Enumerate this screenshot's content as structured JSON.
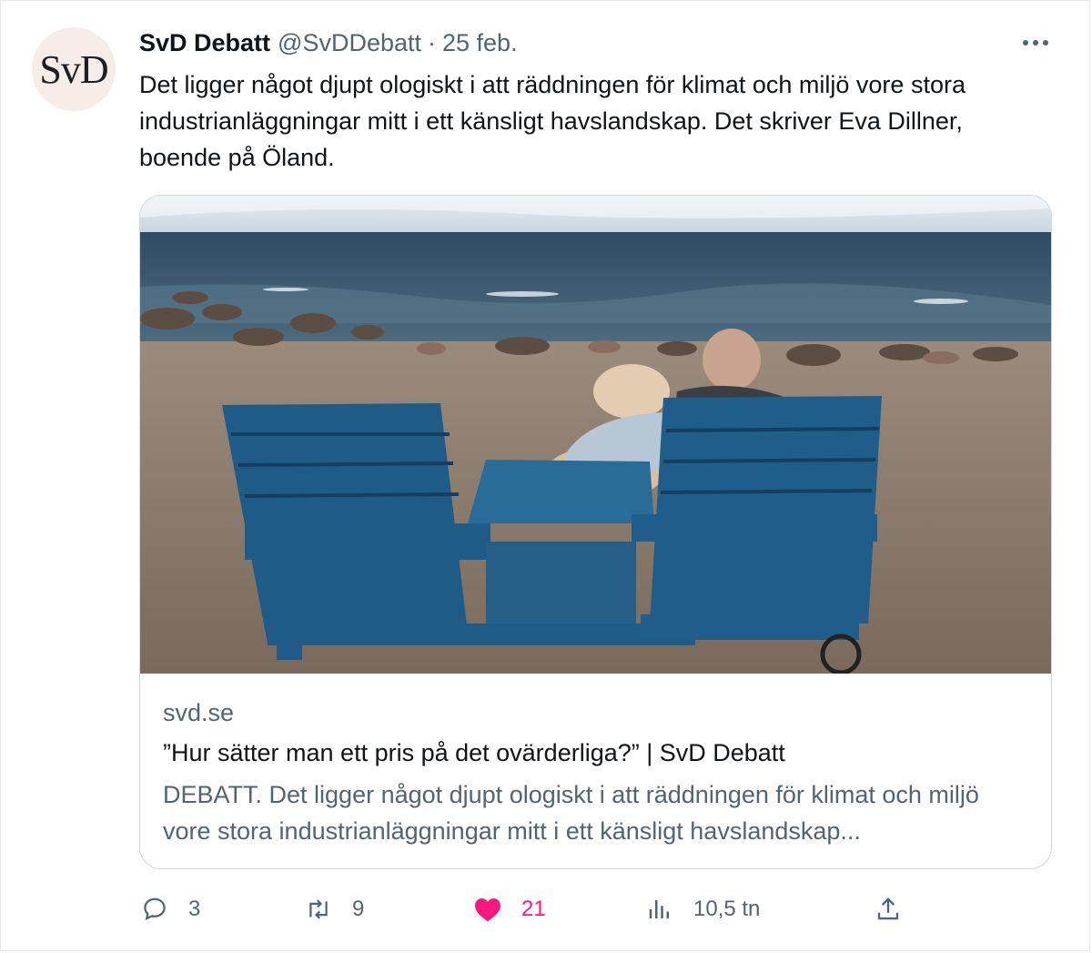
{
  "tweet": {
    "avatar_text": "SvD",
    "name": "SvD Debatt",
    "handle": "@SvDDebatt",
    "separator": "·",
    "date": "25 feb.",
    "text": "Det ligger något djupt ologiskt i att räddningen för klimat och miljö vore stora industrianläggningar mitt i ett känsligt havslandskap. Det skriver Eva Dillner, boende på Öland."
  },
  "card": {
    "domain": "svd.se",
    "title": "”Hur sätter man ett pris på det ovärderliga?” | SvD Debatt",
    "description": "DEBATT. Det ligger något djupt ologiskt i att räddningen för klimat och miljö vore stora industrianläggningar mitt i ett känsligt havslandskap..."
  },
  "actions": {
    "replies": "3",
    "retweets": "9",
    "likes": "21",
    "views": "10,5 tn"
  },
  "icons": {
    "more": "more-icon",
    "reply": "reply-icon",
    "retweet": "retweet-icon",
    "like": "heart-icon",
    "views": "views-icon",
    "share": "share-icon"
  },
  "colors": {
    "text": "#0f1419",
    "secondary": "#536471",
    "like": "#f91880",
    "border": "#cfd9de"
  }
}
